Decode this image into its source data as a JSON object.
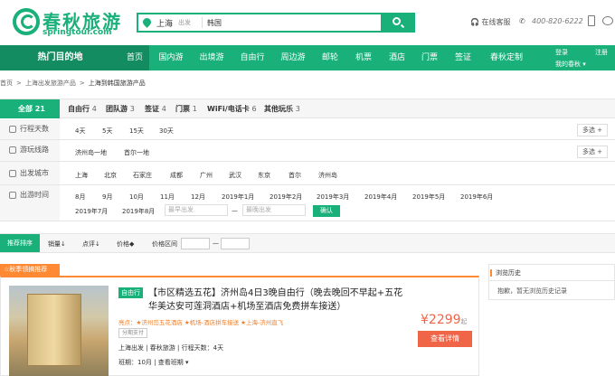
{
  "brand": {
    "name": "春秋旅游",
    "url": "springtour.com",
    "accent": "#19b07a"
  },
  "search": {
    "city": "上海",
    "depart_label": "出发",
    "query": "韩国"
  },
  "header": {
    "service": "在线客服",
    "phone": "400-820-6222"
  },
  "nav": {
    "dest": "热门目的地",
    "items": [
      "首页",
      "国内游",
      "出境游",
      "自由行",
      "周边游",
      "邮轮",
      "机票",
      "酒店",
      "门票",
      "签证",
      "春秋定制"
    ],
    "active": 0,
    "login": "登录",
    "register": "注册",
    "mine": "我的春秋 ▾"
  },
  "breadcrumb": [
    "首页",
    ">",
    "上海出发旅游产品",
    ">",
    "上海到韩国旅游产品"
  ],
  "filter": {
    "all_label": "全部",
    "all_count": "21",
    "tabs": [
      {
        "label": "自由行",
        "count": "4"
      },
      {
        "label": "团队游",
        "count": "3"
      },
      {
        "label": "签证",
        "count": "4"
      },
      {
        "label": "门票",
        "count": "1"
      },
      {
        "label": "WiFi/电话卡",
        "count": "6"
      },
      {
        "label": "其他玩乐",
        "count": "3"
      }
    ],
    "days": {
      "label": "行程天数",
      "options": [
        "4天",
        "5天",
        "15天",
        "30天"
      ]
    },
    "route": {
      "label": "游玩线路",
      "options": [
        "济州岛一地",
        "首尔一地"
      ]
    },
    "city": {
      "label": "出发城市",
      "options": [
        "上海",
        "北京",
        "石家庄",
        "成都",
        "广州",
        "武汉",
        "东京",
        "首尔",
        "济州岛"
      ]
    },
    "date": {
      "label": "出游时间",
      "options": [
        "8月",
        "9月",
        "10月",
        "11月",
        "12月",
        "2019年1月",
        "2019年2月",
        "2019年3月",
        "2019年4月",
        "2019年5月",
        "2019年6月",
        "2019年7月",
        "2019年8月"
      ],
      "earliest": "最早出发",
      "latest": "最晚出发",
      "dash": "—",
      "confirm": "确认"
    },
    "more": "多选 +"
  },
  "sort": {
    "recommended": "推荐排序",
    "sales": "销量↓",
    "rating": "点评↓",
    "price": "价格◆",
    "price_range": "价格区间",
    "dash": "—"
  },
  "season_tag": "☆秋季领搞推荐",
  "product": {
    "type": "自由行",
    "title": "【市区精选五花】济州岛4日3晚自由行（晚去晚回不早起+五花华美达安可莲洞酒店+机场至酒店免费拼车接送）",
    "subtitle": "亮点：★济州岛五花酒店 ★机场-酒店拼车接送 ★上海-济州直飞",
    "installment": "分期支付",
    "info": "上海出发 | 春秋旅游 | 行程天数：4天",
    "schedule": "班期：10月 | 查看班期 ▾",
    "price": "¥2299",
    "price_suffix": "起",
    "detail_btn": "查看详情"
  },
  "history": {
    "title": "浏览历史",
    "empty": "抱歉，暂无浏览历史记录"
  }
}
